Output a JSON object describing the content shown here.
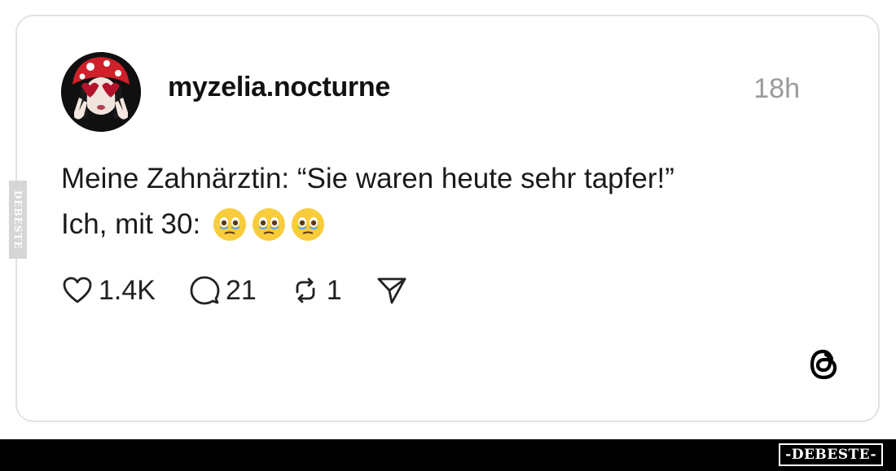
{
  "post": {
    "username": "myzelia.nocturne",
    "time": "18h",
    "text_line1": "Meine Zahnärztin: “Sie waren heute sehr tapfer!”",
    "text_line2": "Ich, mit 30:",
    "emojis": [
      "holding-back-tears-emoji",
      "holding-back-tears-emoji",
      "holding-back-tears-emoji"
    ]
  },
  "actions": {
    "likes": "1.4K",
    "replies": "21",
    "reposts": "1"
  },
  "icons": {
    "like": "heart-icon",
    "reply": "comment-icon",
    "repost": "repost-icon",
    "share": "send-icon",
    "logo": "threads-logo-icon"
  },
  "watermark": {
    "side": "DEBESTE",
    "footer": "-DEBESTE-"
  },
  "colors": {
    "text": "#111111",
    "muted": "#9a9a9a",
    "border": "#e2e2e2",
    "footer": "#000000"
  }
}
